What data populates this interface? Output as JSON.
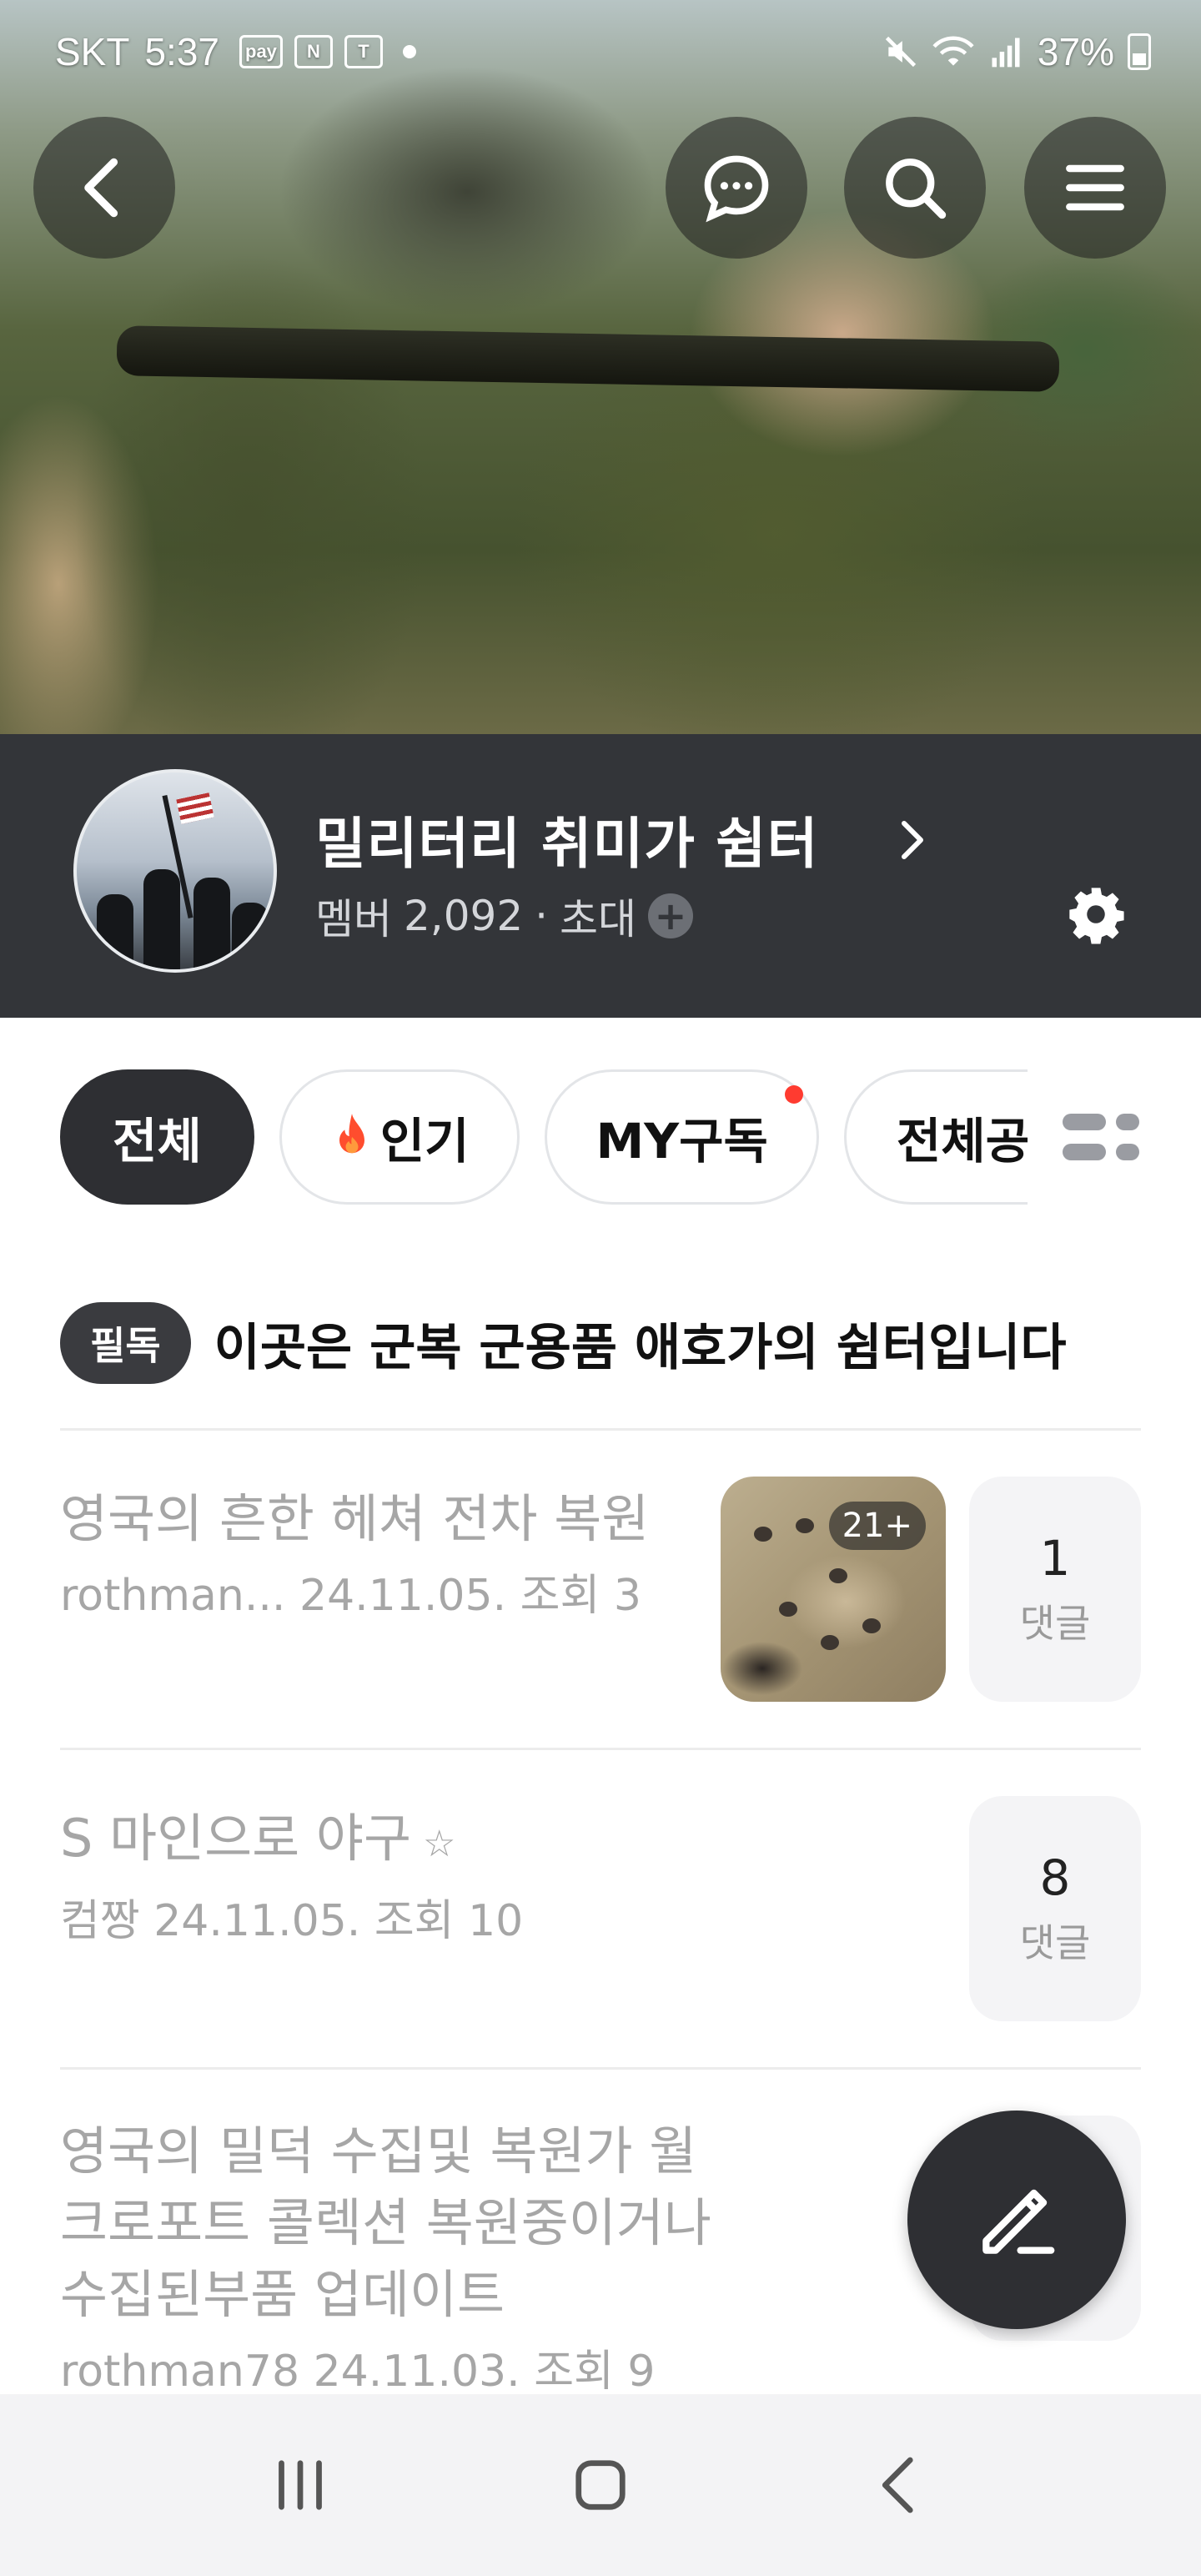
{
  "status_bar": {
    "carrier": "SKT",
    "time": "5:37",
    "app_icons": [
      "pay",
      "N",
      "T"
    ],
    "battery": "37%"
  },
  "hero": {
    "back_icon": "chevron-left-icon",
    "chat_icon": "chat-bubble-icon",
    "search_icon": "search-icon",
    "menu_icon": "hamburger-icon"
  },
  "cafe": {
    "name": "밀리터리 취미가 쉼터",
    "members_label": "멤버",
    "members_count": "2,092",
    "separator": "·",
    "invite_label": "초대",
    "invite_plus": "+"
  },
  "tabs": [
    {
      "label": "전체",
      "active": true
    },
    {
      "label": "인기",
      "icon": "fire-icon"
    },
    {
      "label": "MY구독",
      "has_new": true
    },
    {
      "label": "전체공"
    }
  ],
  "notice": {
    "badge": "필독",
    "title": "이곳은 군복 군용품 애호가의 쉼터입니다"
  },
  "posts": [
    {
      "title_lines": [
        "영국의 흔한 헤쳐 전차 복원"
      ],
      "author": "rothman...",
      "date": "24.11.05.",
      "views_label": "조회",
      "views": "3",
      "thumb_count": "21+",
      "comments": "1",
      "comments_label": "댓글"
    },
    {
      "title_lines": [
        "S 마인으로 야구"
      ],
      "title_suffix_icon": "☆",
      "author": "컴짱",
      "date": "24.11.05.",
      "views_label": "조회",
      "views": "10",
      "comments": "8",
      "comments_label": "댓글"
    },
    {
      "title_lines": [
        "영국의 밀덕 수집및 복원가 월",
        "크로포트 콜렉션 복원중이거나",
        "수집된부품 업데이트"
      ],
      "author": "rothman78",
      "date": "24.11.03.",
      "views_label": "조회",
      "views": "9"
    }
  ],
  "fab": {
    "icon": "pencil-icon"
  },
  "nav": {
    "recents_icon": "recents-icon",
    "home_icon": "home-icon",
    "back_icon": "back-icon"
  }
}
